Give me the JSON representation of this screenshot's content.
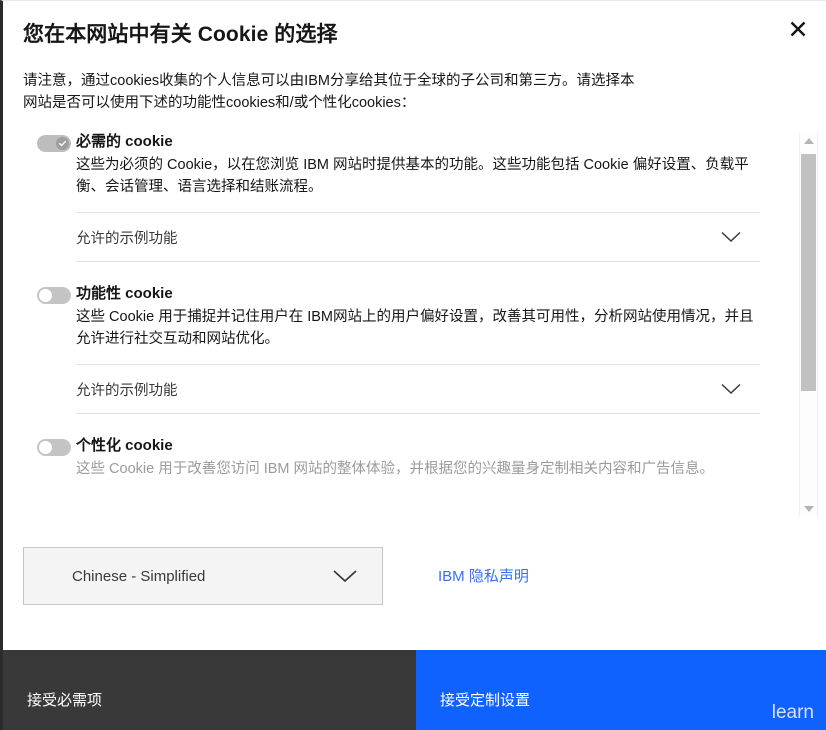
{
  "dialog": {
    "title": "您在本网站中有关 Cookie 的选择",
    "intro": "请注意，通过cookies收集的个人信息可以由IBM分享给其位于全球的子公司和第三方。请选择本网站是否可以使用下述的功能性cookies和/或个性化cookies：",
    "close_label": "×"
  },
  "categories": [
    {
      "name": "必需的 cookie",
      "description": "这些为必须的 Cookie，以在您浏览 IBM 网站时提供基本的功能。这些功能包括 Cookie 偏好设置、负载平衡、会话管理、语言选择和结账流程。",
      "toggle_state": "on-locked",
      "expander_label": "允许的示例功能"
    },
    {
      "name": "功能性 cookie",
      "description": "这些 Cookie 用于捕捉并记住用户在 IBM网站上的用户偏好设置，改善其可用性，分析网站使用情况，并且允许进行社交互动和网站优化。",
      "toggle_state": "off",
      "expander_label": "允许的示例功能"
    },
    {
      "name": "个性化 cookie",
      "description": "这些 Cookie 用于改善您访问 IBM 网站的整体体验，并根据您的兴趣量身定制相关内容和广告信息。",
      "toggle_state": "off",
      "expander_label": ""
    }
  ],
  "footer": {
    "language_value": "Chinese - Simplified",
    "privacy_link": "IBM 隐私声明"
  },
  "actions": {
    "accept_essential": "接受必需项",
    "accept_custom": "接受定制设置"
  },
  "background": {
    "page_text": "learn"
  },
  "colors": {
    "accent_blue": "#0f62fe",
    "dark_button": "#393939",
    "link_blue": "#3b6ff0",
    "toggle_track": "#c4c4c4",
    "divider": "#e0e0e0"
  }
}
